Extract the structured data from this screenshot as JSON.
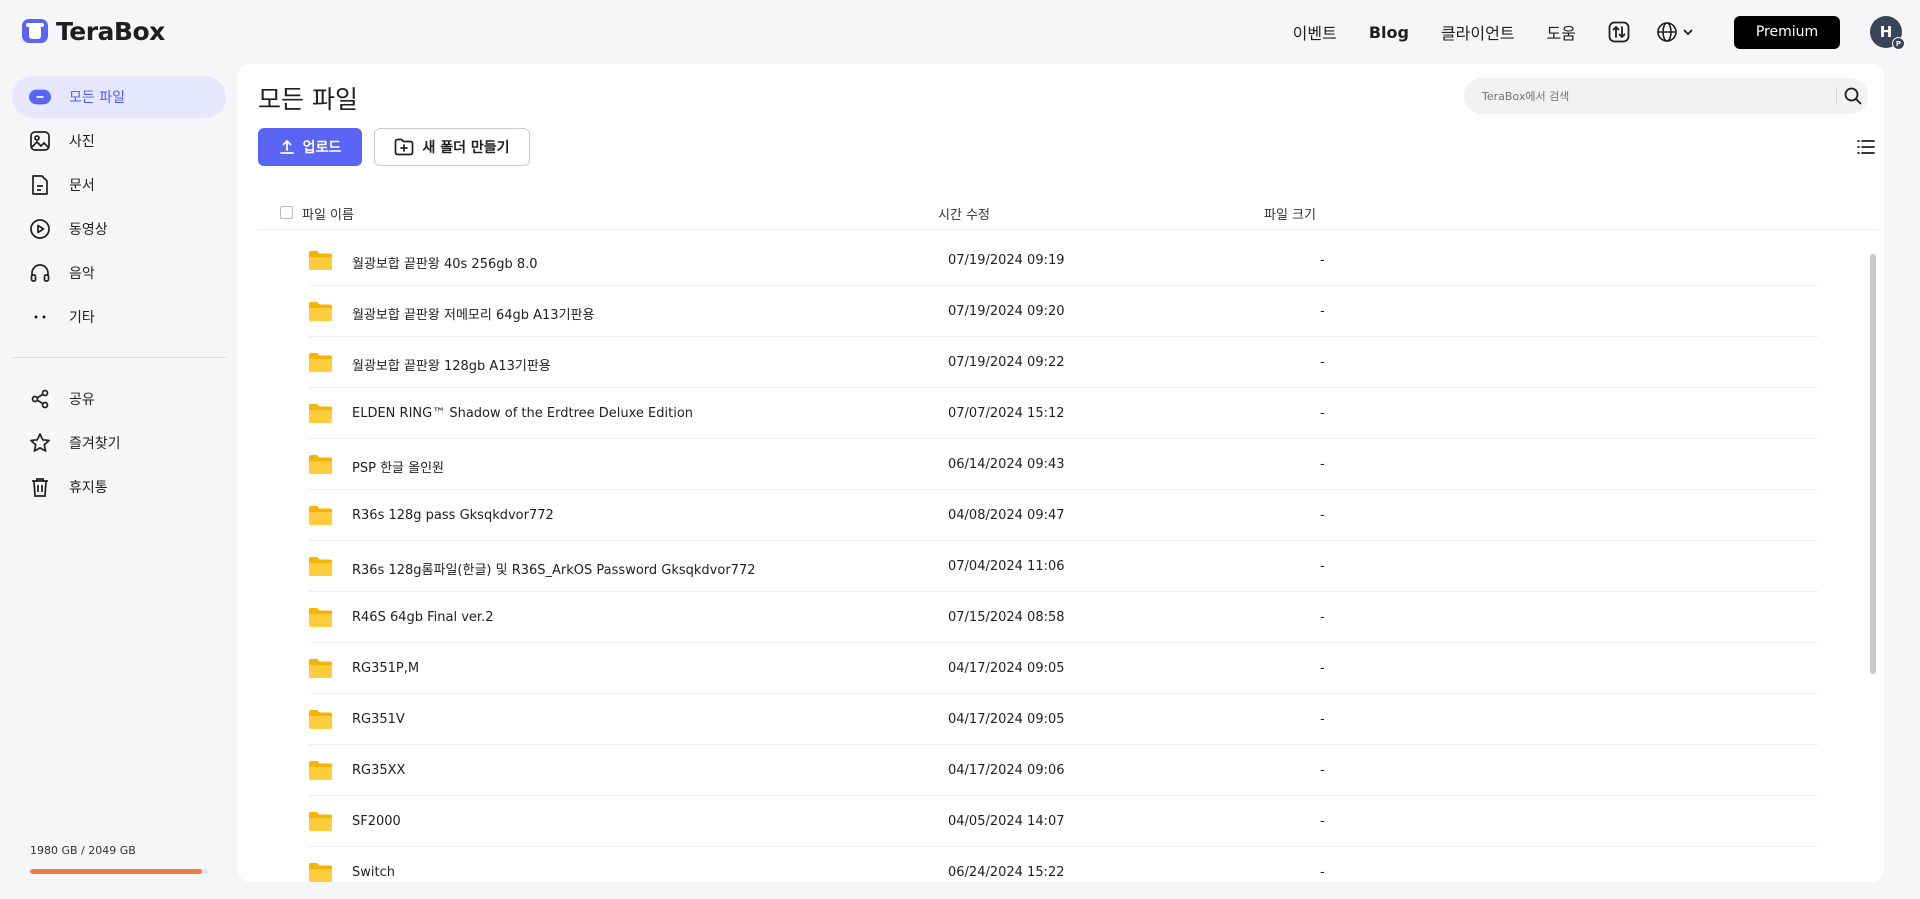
{
  "brand": {
    "name": "TeraBox",
    "accent": "#5a64f5"
  },
  "topnav": {
    "links": [
      "이벤트",
      "Blog",
      "클라이언트",
      "도움"
    ],
    "premium": "Premium",
    "avatar_initial": "H",
    "avatar_badge": "P"
  },
  "sidebar": {
    "items": [
      {
        "label": "모든 파일",
        "icon": "all-files-icon",
        "active": true
      },
      {
        "label": "사진",
        "icon": "photo-icon"
      },
      {
        "label": "문서",
        "icon": "document-icon"
      },
      {
        "label": "동영상",
        "icon": "video-icon"
      },
      {
        "label": "음악",
        "icon": "headphones-icon"
      },
      {
        "label": "기타",
        "icon": "more-icon"
      }
    ],
    "items2": [
      {
        "label": "공유",
        "icon": "share-icon"
      },
      {
        "label": "즐겨찾기",
        "icon": "star-icon"
      },
      {
        "label": "휴지통",
        "icon": "trash-icon"
      }
    ],
    "quota": {
      "text": "1980 GB / 2049 GB",
      "used_fraction": 0.966
    }
  },
  "main": {
    "title": "모든 파일",
    "search_placeholder": "TeraBox에서 검색",
    "upload_label": "업로드",
    "new_folder_label": "새 폴더 만들기",
    "columns": [
      "파일 이름",
      "시간 수정",
      "파일 크기"
    ],
    "files": [
      {
        "name": "월광보합 끝판왕 40s 256gb 8.0",
        "time": "07/19/2024 09:19",
        "size": "-"
      },
      {
        "name": "월광보합 끝판왕 저메모리 64gb A13기판용",
        "time": "07/19/2024 09:20",
        "size": "-"
      },
      {
        "name": "월광보합 끝판왕 128gb A13기판용",
        "time": "07/19/2024 09:22",
        "size": "-"
      },
      {
        "name": "ELDEN RING™ Shadow of the Erdtree Deluxe Edition",
        "time": "07/07/2024 15:12",
        "size": "-"
      },
      {
        "name": "PSP 한글 올인원",
        "time": "06/14/2024 09:43",
        "size": "-"
      },
      {
        "name": "R36s 128g pass Gksqkdvor772",
        "time": "04/08/2024 09:47",
        "size": "-"
      },
      {
        "name": "R36s 128g롬파일(한글) 및 R36S_ArkOS Password Gksqkdvor772",
        "time": "07/04/2024 11:06",
        "size": "-"
      },
      {
        "name": "R46S 64gb Final ver.2",
        "time": "07/15/2024 08:58",
        "size": "-"
      },
      {
        "name": "RG351P,M",
        "time": "04/17/2024 09:05",
        "size": "-"
      },
      {
        "name": "RG351V",
        "time": "04/17/2024 09:05",
        "size": "-"
      },
      {
        "name": "RG35XX",
        "time": "04/17/2024 09:06",
        "size": "-"
      },
      {
        "name": "SF2000",
        "time": "04/05/2024 14:07",
        "size": "-"
      },
      {
        "name": "Switch",
        "time": "06/24/2024 15:22",
        "size": "-"
      }
    ]
  }
}
